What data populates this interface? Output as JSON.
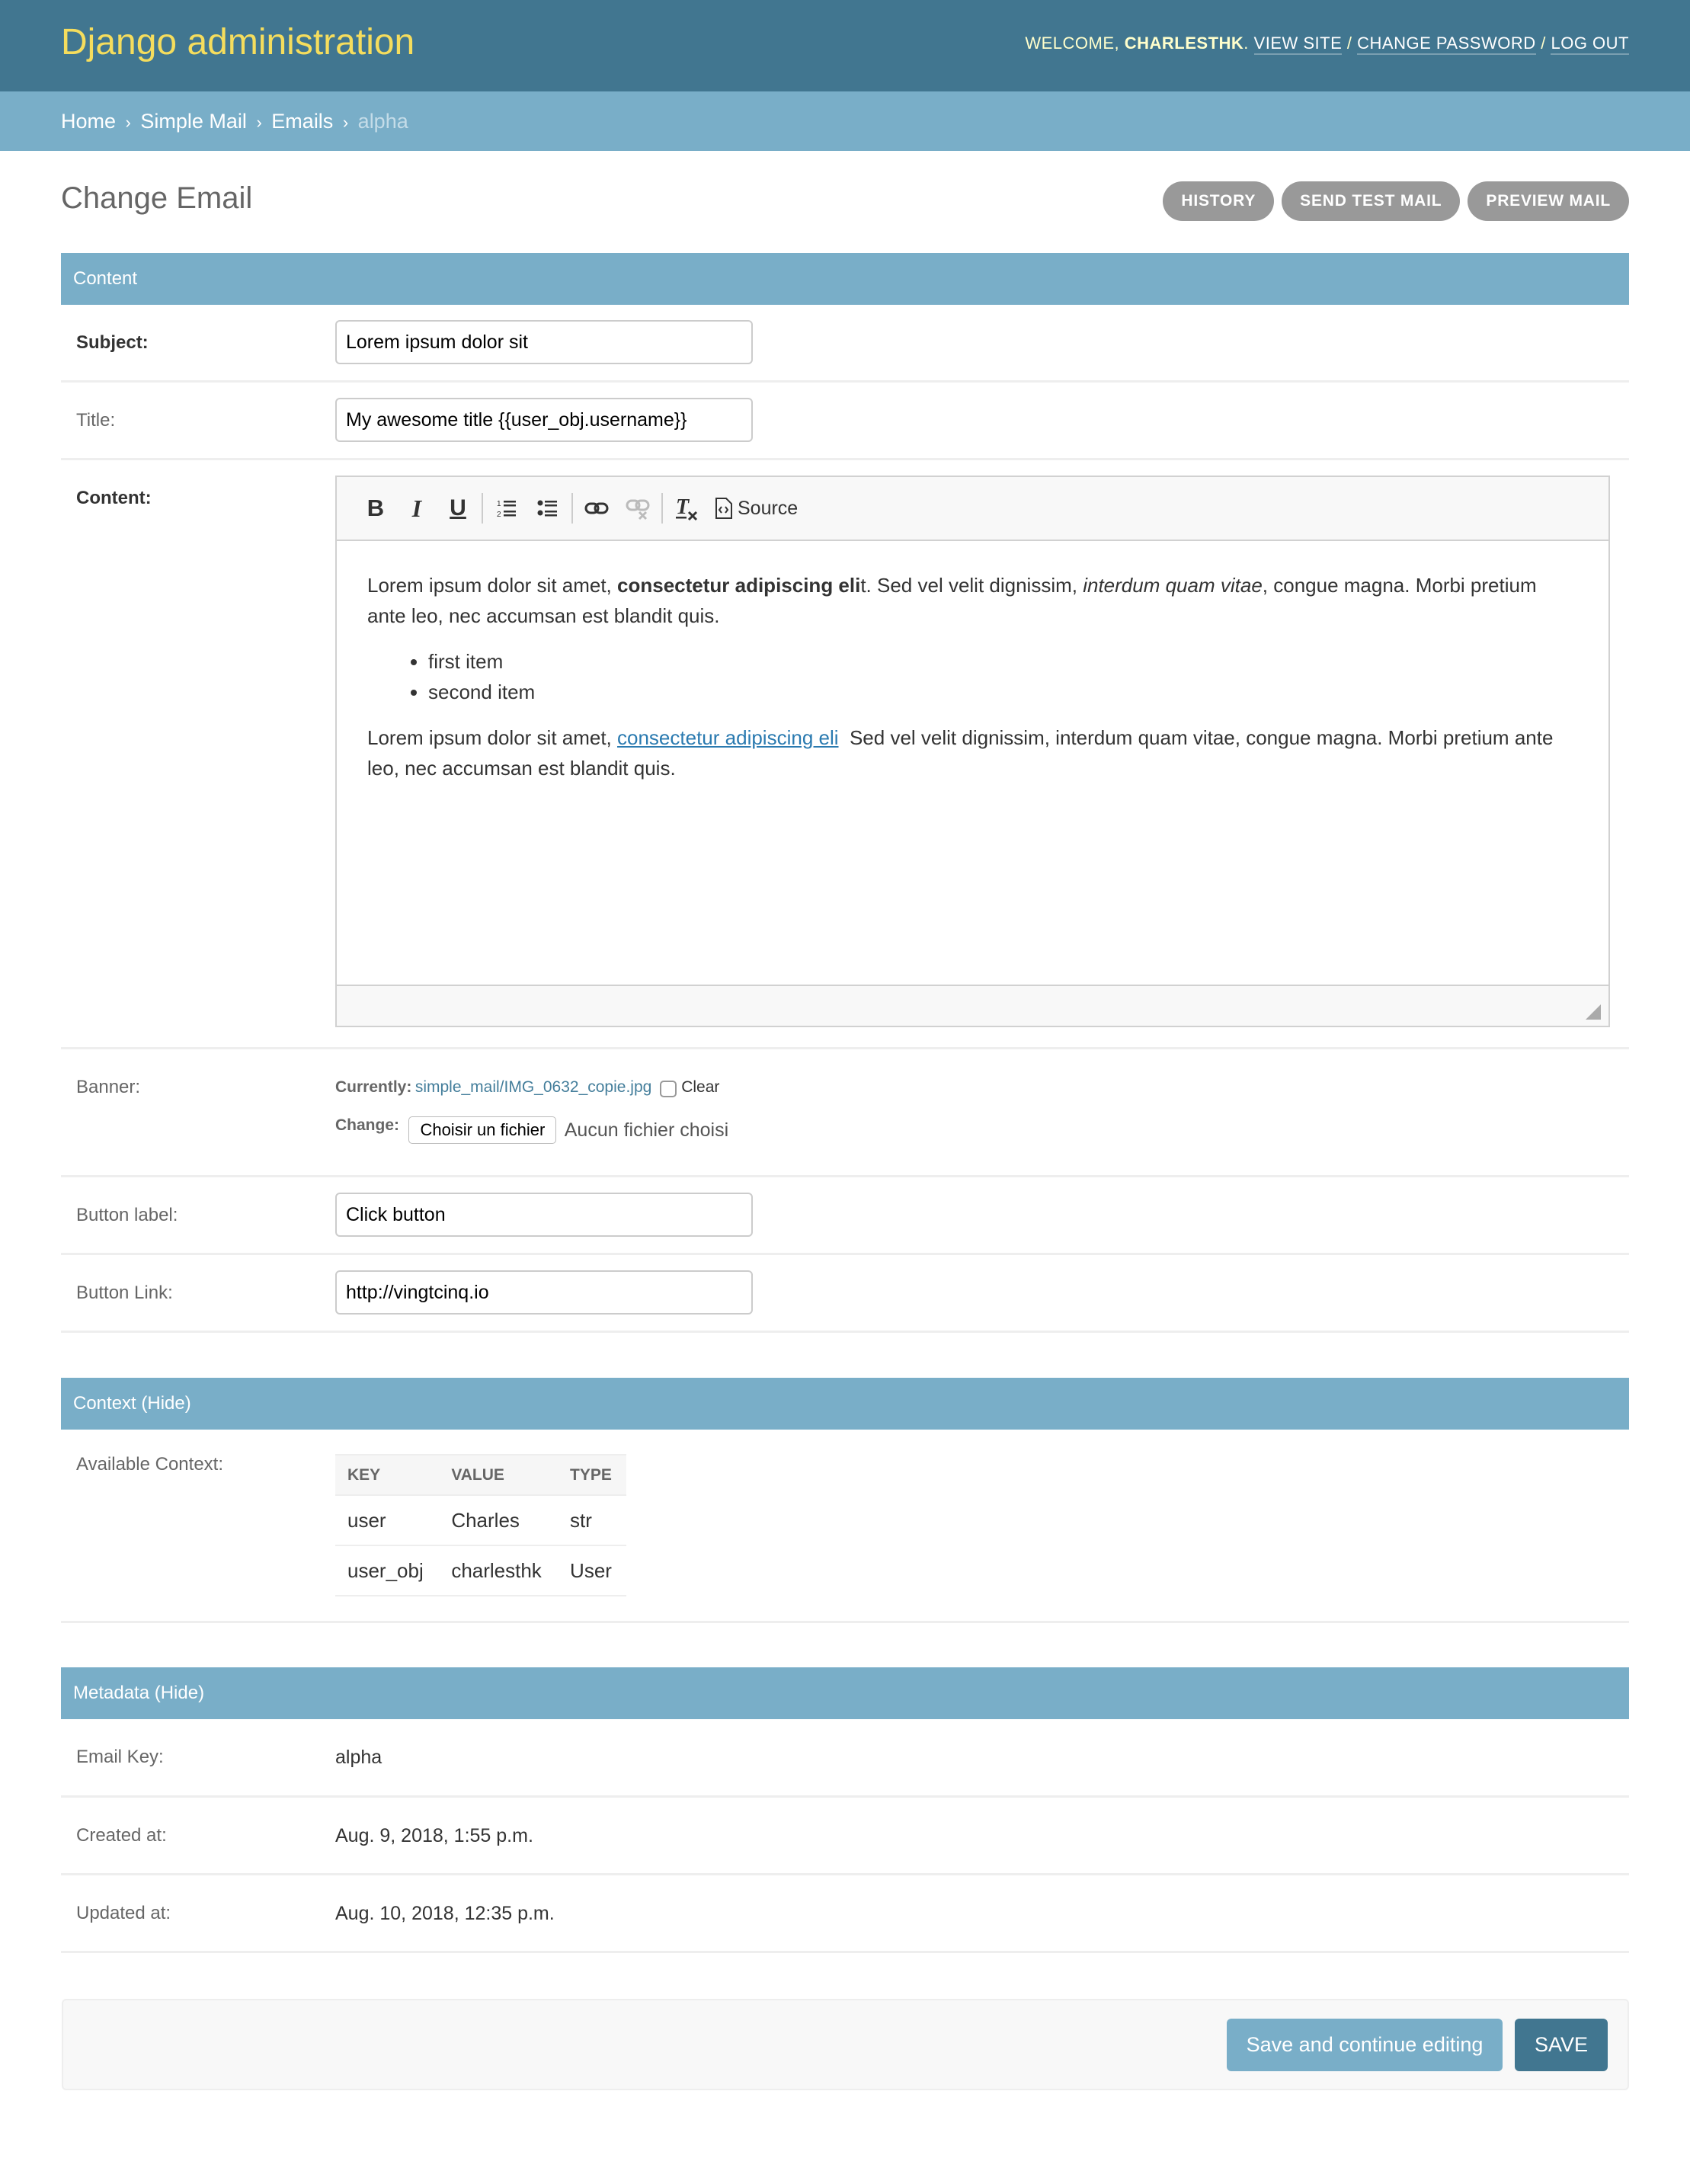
{
  "header": {
    "site_title": "Django administration",
    "welcome_prefix": "Welcome,",
    "username": "charlesthk",
    "links": [
      "View site",
      "Change password",
      "Log out"
    ],
    "separator": "/"
  },
  "breadcrumbs": {
    "items": [
      "Home",
      "Simple Mail",
      "Emails"
    ],
    "current": "alpha",
    "separator": "›"
  },
  "page": {
    "title": "Change Email",
    "object_tools": [
      "History",
      "Send test mail",
      "Preview mail"
    ]
  },
  "fieldsets": {
    "content": {
      "title": "Content",
      "subject": {
        "label": "Subject:",
        "value": "Lorem ipsum dolor sit"
      },
      "title_field": {
        "label": "Title:",
        "value": "My awesome title {{user_obj.username}}"
      },
      "content": {
        "label": "Content:",
        "toolbar": {
          "buttons": [
            {
              "name": "bold",
              "glyph": "B"
            },
            {
              "name": "italic",
              "glyph": "I"
            },
            {
              "name": "underline",
              "glyph": "U"
            },
            {
              "name": "numbered-list",
              "glyph": "numbered-list-icon"
            },
            {
              "name": "bulleted-list",
              "glyph": "bulleted-list-icon"
            },
            {
              "name": "link",
              "glyph": "link-icon"
            },
            {
              "name": "unlink",
              "glyph": "unlink-icon"
            },
            {
              "name": "remove-format",
              "glyph": "T"
            }
          ],
          "source_label": "Source"
        },
        "body": {
          "p1_start": "Lorem ipsum dolor sit amet, ",
          "p1_bold": "consectetur adipiscing eli",
          "p1_mid": "t. Sed vel velit dignissim, ",
          "p1_italic": "interdum quam vitae",
          "p1_end": ", congue magna. Morbi pretium ante leo, nec accumsan est blandit quis.",
          "list": [
            "first item",
            "second item"
          ],
          "p2_start": "Lorem ipsum dolor sit amet, ",
          "p2_link": "consectetur adipiscing eli",
          "p2_end": "  Sed vel velit dignissim, interdum quam vitae, congue magna. Morbi pretium ante leo, nec accumsan est blandit quis."
        }
      },
      "banner": {
        "label": "Banner:",
        "currently_label": "Currently:",
        "current_file": "simple_mail/IMG_0632_copie.jpg",
        "clear_label": "Clear",
        "clear_checked": false,
        "change_label": "Change:",
        "choose_button": "Choisir un fichier",
        "no_file_text": "Aucun fichier choisi"
      },
      "button_label": {
        "label": "Button label:",
        "value": "Click button"
      },
      "button_link": {
        "label": "Button Link:",
        "value": "http://vingtcinq.io"
      }
    },
    "context": {
      "title": "Context (Hide)",
      "label": "Available Context:",
      "columns": [
        "Key",
        "Value",
        "Type"
      ],
      "rows": [
        {
          "key": "user",
          "value": "Charles",
          "type": "str"
        },
        {
          "key": "user_obj",
          "value": "charlesthk",
          "type": "User"
        }
      ]
    },
    "metadata": {
      "title": "Metadata (Hide)",
      "fields": [
        {
          "label": "Email Key:",
          "value": "alpha"
        },
        {
          "label": "Created at:",
          "value": "Aug. 9, 2018, 1:55 p.m."
        },
        {
          "label": "Updated at:",
          "value": "Aug. 10, 2018, 12:35 p.m."
        }
      ]
    }
  },
  "submit": {
    "save_continue": "Save and continue editing",
    "save": "Save"
  },
  "colors": {
    "header_bg": "#417690",
    "breadcrumb_bg": "#79aec8",
    "brand_text": "#f5dd5d",
    "object_tool_bg": "#999999",
    "link": "#447e9b",
    "editor_link": "#2a7ab0"
  }
}
